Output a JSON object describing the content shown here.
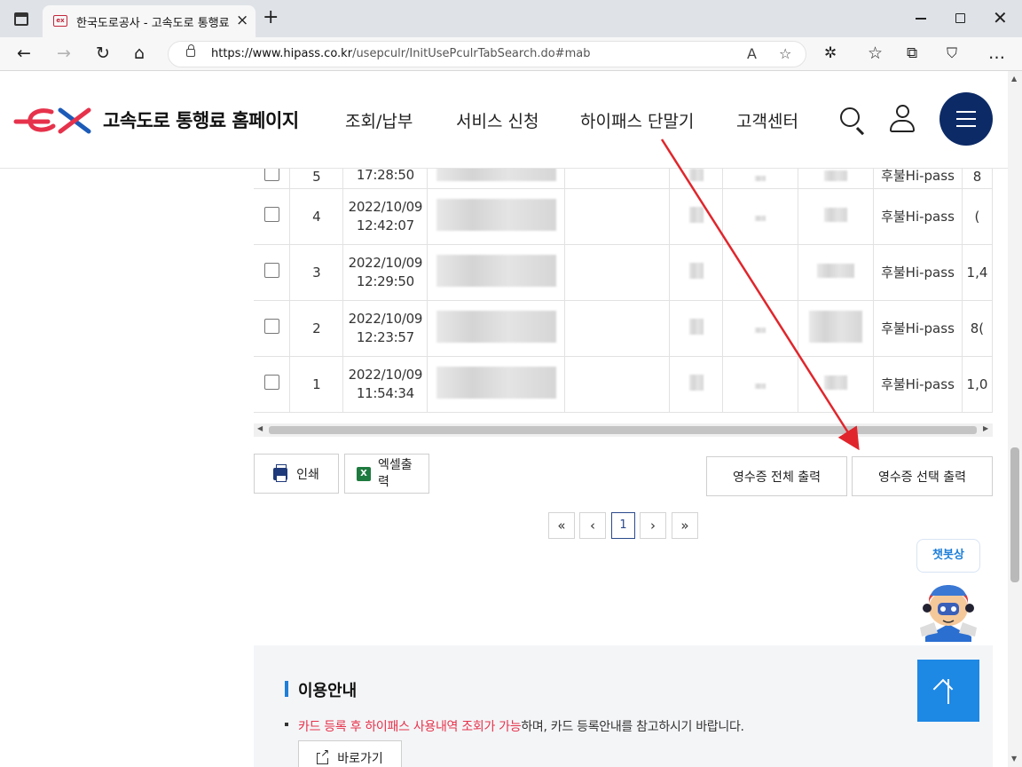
{
  "browser": {
    "tab_title": "한국도로공사 - 고속도로 통행료",
    "url_host": "https://www.hipass.co.kr",
    "url_path": "/usepculr/InitUsePculrTabSearch.do#mab"
  },
  "header": {
    "logo_text": "고속도로 통행료 홈페이지",
    "nav": [
      "조회/납부",
      "서비스 신청",
      "하이패스 단말기",
      "고객센터"
    ],
    "brand_color": "#0c2a66"
  },
  "table": {
    "rows": [
      {
        "no": "5",
        "date": "",
        "time": "17:28:50",
        "type": "후불Hi-pass",
        "amount": "8"
      },
      {
        "no": "4",
        "date": "2022/10/09",
        "time": "12:42:07",
        "type": "후불Hi-pass",
        "amount": "("
      },
      {
        "no": "3",
        "date": "2022/10/09",
        "time": "12:29:50",
        "type": "후불Hi-pass",
        "amount": "1,4"
      },
      {
        "no": "2",
        "date": "2022/10/09",
        "time": "12:23:57",
        "type": "후불Hi-pass",
        "amount": "8("
      },
      {
        "no": "1",
        "date": "2022/10/09",
        "time": "11:54:34",
        "type": "후불Hi-pass",
        "amount": "1,0"
      }
    ]
  },
  "actions": {
    "print_label": "인쇄",
    "excel_label": "엑셀출력",
    "receipt_all_label": "영수증 전체 출력",
    "receipt_selected_label": "영수증 선택 출력"
  },
  "pagination": {
    "first": "«",
    "prev": "‹",
    "current": "1",
    "next": "›",
    "last": "»"
  },
  "chatbot": {
    "label": "챗봇상"
  },
  "info": {
    "title": "이용안내",
    "text_highlight": "카드 등록 후 하이패스 사용내역 조회가 가능",
    "text_rest": "하며, 카드 등록안내를 참고하시기 바랍니다.",
    "goto_label": "바로가기"
  },
  "colors": {
    "accent_blue": "#1e88e5",
    "highlight_red": "#e6324b",
    "annotation_red": "#e0262c"
  }
}
